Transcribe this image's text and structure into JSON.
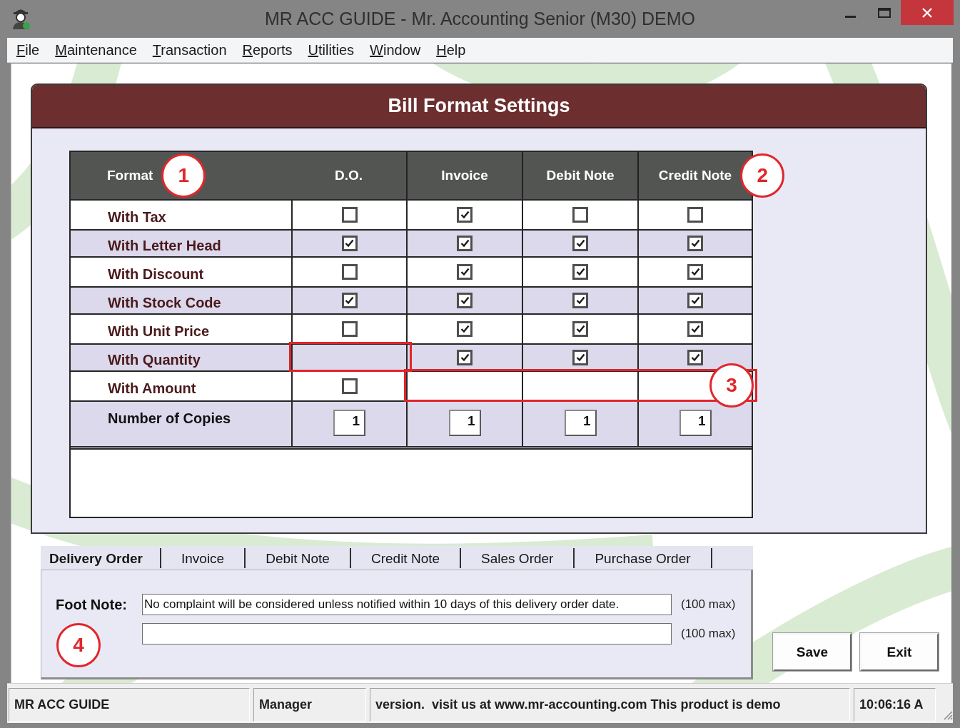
{
  "window": {
    "title": "MR ACC GUIDE - Mr. Accounting Senior (M30) DEMO"
  },
  "menu_bar": [
    "File",
    "Maintenance",
    "Transaction",
    "Reports",
    "Utilities",
    "Window",
    "Help"
  ],
  "panel": {
    "title": "Bill Format Settings"
  },
  "table": {
    "columns": [
      {
        "label": "Format",
        "callout": "1"
      },
      {
        "label": "D.O."
      },
      {
        "label": "Invoice"
      },
      {
        "label": "Debit Note"
      },
      {
        "label": "Credit Note",
        "callout": "2"
      }
    ],
    "rows": [
      {
        "kind": "checkbox",
        "cells": [
          {
            "kind": "label",
            "text": "With Tax",
            "highlighted": false
          },
          {
            "kind": "checkbox",
            "checked": false,
            "highlighted": false
          },
          {
            "kind": "checkbox",
            "checked": true,
            "highlighted": false
          },
          {
            "kind": "checkbox",
            "checked": false,
            "highlighted": false
          },
          {
            "kind": "checkbox",
            "checked": false,
            "highlighted": false
          }
        ]
      },
      {
        "kind": "checkbox",
        "cells": [
          {
            "kind": "label",
            "text": "With Letter Head",
            "highlighted": false
          },
          {
            "kind": "checkbox",
            "checked": true,
            "highlighted": false
          },
          {
            "kind": "checkbox",
            "checked": true,
            "highlighted": false
          },
          {
            "kind": "checkbox",
            "checked": true,
            "highlighted": false
          },
          {
            "kind": "checkbox",
            "checked": true,
            "highlighted": false
          }
        ]
      },
      {
        "kind": "checkbox",
        "cells": [
          {
            "kind": "label",
            "text": "With Discount",
            "highlighted": false
          },
          {
            "kind": "checkbox",
            "checked": false,
            "highlighted": false
          },
          {
            "kind": "checkbox",
            "checked": true,
            "highlighted": false
          },
          {
            "kind": "checkbox",
            "checked": true,
            "highlighted": false
          },
          {
            "kind": "checkbox",
            "checked": true,
            "highlighted": false
          }
        ]
      },
      {
        "kind": "checkbox",
        "cells": [
          {
            "kind": "label",
            "text": "With Stock Code",
            "highlighted": false
          },
          {
            "kind": "checkbox",
            "checked": true,
            "highlighted": false
          },
          {
            "kind": "checkbox",
            "checked": true,
            "highlighted": false
          },
          {
            "kind": "checkbox",
            "checked": true,
            "highlighted": false
          },
          {
            "kind": "checkbox",
            "checked": true,
            "highlighted": false
          }
        ]
      },
      {
        "kind": "checkbox",
        "cells": [
          {
            "kind": "label",
            "text": "With Unit Price",
            "highlighted": false
          },
          {
            "kind": "checkbox",
            "checked": false,
            "highlighted": false
          },
          {
            "kind": "checkbox",
            "checked": true,
            "highlighted": false
          },
          {
            "kind": "checkbox",
            "checked": true,
            "highlighted": false
          },
          {
            "kind": "checkbox",
            "checked": true,
            "highlighted": false
          }
        ]
      },
      {
        "kind": "checkbox",
        "cells": [
          {
            "kind": "label",
            "text": "With Quantity",
            "highlighted": false
          },
          {
            "kind": "empty",
            "highlighted": true
          },
          {
            "kind": "checkbox",
            "checked": true,
            "highlighted": false
          },
          {
            "kind": "checkbox",
            "checked": true,
            "highlighted": false
          },
          {
            "kind": "checkbox",
            "checked": true,
            "highlighted": false
          }
        ]
      },
      {
        "kind": "checkbox",
        "callout": "3",
        "cells": [
          {
            "kind": "label",
            "text": "With Amount",
            "highlighted": false
          },
          {
            "kind": "checkbox",
            "checked": false,
            "highlighted": false
          },
          {
            "kind": "empty",
            "highlighted": true
          },
          {
            "kind": "empty",
            "highlighted": true
          },
          {
            "kind": "empty",
            "highlighted": true
          }
        ]
      },
      {
        "kind": "copies",
        "cells": [
          {
            "kind": "label",
            "text": "Number of Copies",
            "highlighted": false
          },
          {
            "kind": "number",
            "value": "1",
            "highlighted": false
          },
          {
            "kind": "number",
            "value": "1",
            "highlighted": false
          },
          {
            "kind": "number",
            "value": "1",
            "highlighted": false
          },
          {
            "kind": "number",
            "value": "1",
            "highlighted": false
          }
        ]
      }
    ]
  },
  "tabs": [
    {
      "label": "Delivery Order",
      "selected": true
    },
    {
      "label": "Invoice",
      "selected": false
    },
    {
      "label": "Debit Note",
      "selected": false
    },
    {
      "label": "Credit Note",
      "selected": false
    },
    {
      "label": "Sales Order",
      "selected": false
    },
    {
      "label": "Purchase Order",
      "selected": false
    }
  ],
  "foot_note": {
    "label": "Foot Note:",
    "callout": "4",
    "lines": [
      {
        "value": "No complaint will be considered unless notified within 10 days of this delivery order date.",
        "limit": "(100 max)"
      },
      {
        "limit": "(100 max)"
      }
    ]
  },
  "buttons": [
    {
      "label": "Save"
    },
    {
      "label": "Exit"
    }
  ],
  "status_bar": [
    "MR ACC GUIDE",
    "Manager",
    "version.  visit us at www.mr-accounting.com This product is demo",
    "10:06:16 A"
  ]
}
